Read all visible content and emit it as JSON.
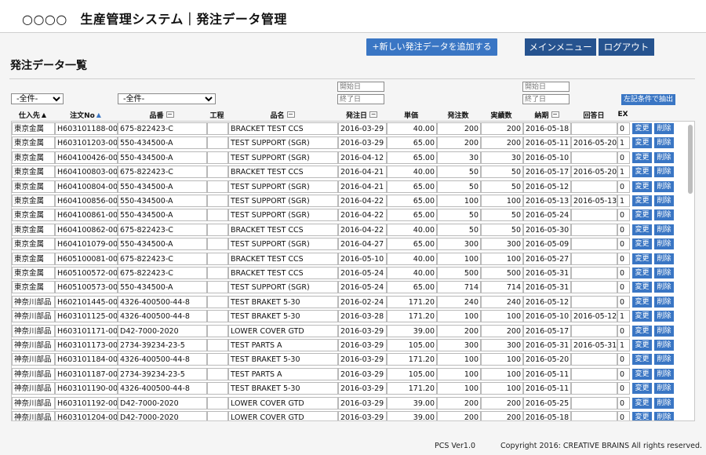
{
  "header": {
    "title": "○○○○　生産管理システム｜発注データ管理",
    "add_button": "+新しい発注データを追加する",
    "main_menu_button": "メインメニュー",
    "logout_button": "ログアウト"
  },
  "page": {
    "title": "発注データ一覧"
  },
  "filters": {
    "supplier_select": "-全件-",
    "part_select": "-全件-",
    "order_date_start_placeholder": "開始日",
    "order_date_end_placeholder": "終了日",
    "delivery_date_start_placeholder": "開始日",
    "delivery_date_end_placeholder": "終了日",
    "apply_button": "左記条件で抽出"
  },
  "columns": {
    "supplier": "仕入先",
    "order_no": "注文No",
    "part_no": "品番",
    "process": "工程",
    "part_name": "品名",
    "order_date": "発注日",
    "unit_price": "単価",
    "order_qty": "発注数",
    "actual_qty": "実績数",
    "delivery_date": "納期",
    "reply_date": "回答日",
    "ex": "EX"
  },
  "icons": {
    "sort_asc": "▲",
    "filter": "−"
  },
  "row_buttons": {
    "edit": "変更",
    "delete": "削除"
  },
  "rows": [
    {
      "supplier": "東京金属",
      "order_no": "H603101188-00",
      "part_no": "675-822423-C",
      "process": "",
      "part_name": "BRACKET TEST CCS",
      "order_date": "2016-03-29",
      "unit_price": "40.00",
      "order_qty": "200",
      "actual_qty": "200",
      "delivery_date": "2016-05-18",
      "reply_date": "",
      "ex": "0"
    },
    {
      "supplier": "東京金属",
      "order_no": "H603101203-00",
      "part_no": "550-434500-A",
      "process": "",
      "part_name": "TEST SUPPORT (SGR)",
      "order_date": "2016-03-29",
      "unit_price": "65.00",
      "order_qty": "200",
      "actual_qty": "200",
      "delivery_date": "2016-05-11",
      "reply_date": "2016-05-20",
      "ex": "1"
    },
    {
      "supplier": "東京金属",
      "order_no": "H604100426-00",
      "part_no": "550-434500-A",
      "process": "",
      "part_name": "TEST SUPPORT (SGR)",
      "order_date": "2016-04-12",
      "unit_price": "65.00",
      "order_qty": "30",
      "actual_qty": "30",
      "delivery_date": "2016-05-10",
      "reply_date": "",
      "ex": "0"
    },
    {
      "supplier": "東京金属",
      "order_no": "H604100803-00",
      "part_no": "675-822423-C",
      "process": "",
      "part_name": "BRACKET TEST CCS",
      "order_date": "2016-04-21",
      "unit_price": "40.00",
      "order_qty": "50",
      "actual_qty": "50",
      "delivery_date": "2016-05-17",
      "reply_date": "2016-05-20",
      "ex": "1"
    },
    {
      "supplier": "東京金属",
      "order_no": "H604100804-00",
      "part_no": "550-434500-A",
      "process": "",
      "part_name": "TEST SUPPORT (SGR)",
      "order_date": "2016-04-21",
      "unit_price": "65.00",
      "order_qty": "50",
      "actual_qty": "50",
      "delivery_date": "2016-05-12",
      "reply_date": "",
      "ex": "0"
    },
    {
      "supplier": "東京金属",
      "order_no": "H604100856-00",
      "part_no": "550-434500-A",
      "process": "",
      "part_name": "TEST SUPPORT (SGR)",
      "order_date": "2016-04-22",
      "unit_price": "65.00",
      "order_qty": "100",
      "actual_qty": "100",
      "delivery_date": "2016-05-13",
      "reply_date": "2016-05-13",
      "ex": "1"
    },
    {
      "supplier": "東京金属",
      "order_no": "H604100861-00",
      "part_no": "550-434500-A",
      "process": "",
      "part_name": "TEST SUPPORT (SGR)",
      "order_date": "2016-04-22",
      "unit_price": "65.00",
      "order_qty": "50",
      "actual_qty": "50",
      "delivery_date": "2016-05-24",
      "reply_date": "",
      "ex": "0"
    },
    {
      "supplier": "東京金属",
      "order_no": "H604100862-00",
      "part_no": "675-822423-C",
      "process": "",
      "part_name": "BRACKET TEST CCS",
      "order_date": "2016-04-22",
      "unit_price": "40.00",
      "order_qty": "50",
      "actual_qty": "50",
      "delivery_date": "2016-05-30",
      "reply_date": "",
      "ex": "0"
    },
    {
      "supplier": "東京金属",
      "order_no": "H604101079-00",
      "part_no": "550-434500-A",
      "process": "",
      "part_name": "TEST SUPPORT (SGR)",
      "order_date": "2016-04-27",
      "unit_price": "65.00",
      "order_qty": "300",
      "actual_qty": "300",
      "delivery_date": "2016-05-09",
      "reply_date": "",
      "ex": "0"
    },
    {
      "supplier": "東京金属",
      "order_no": "H605100081-00",
      "part_no": "675-822423-C",
      "process": "",
      "part_name": "BRACKET TEST CCS",
      "order_date": "2016-05-10",
      "unit_price": "40.00",
      "order_qty": "100",
      "actual_qty": "100",
      "delivery_date": "2016-05-27",
      "reply_date": "",
      "ex": "0"
    },
    {
      "supplier": "東京金属",
      "order_no": "H605100572-00",
      "part_no": "675-822423-C",
      "process": "",
      "part_name": "BRACKET TEST CCS",
      "order_date": "2016-05-24",
      "unit_price": "40.00",
      "order_qty": "500",
      "actual_qty": "500",
      "delivery_date": "2016-05-31",
      "reply_date": "",
      "ex": "0"
    },
    {
      "supplier": "東京金属",
      "order_no": "H605100573-00",
      "part_no": "550-434500-A",
      "process": "",
      "part_name": "TEST SUPPORT (SGR)",
      "order_date": "2016-05-24",
      "unit_price": "65.00",
      "order_qty": "714",
      "actual_qty": "714",
      "delivery_date": "2016-05-31",
      "reply_date": "",
      "ex": "0"
    },
    {
      "supplier": "神奈川部品",
      "order_no": "H602101445-00",
      "part_no": "4326-400500-44-8",
      "process": "",
      "part_name": "TEST BRAKET 5-30",
      "order_date": "2016-02-24",
      "unit_price": "171.20",
      "order_qty": "240",
      "actual_qty": "240",
      "delivery_date": "2016-05-12",
      "reply_date": "",
      "ex": "0"
    },
    {
      "supplier": "神奈川部品",
      "order_no": "H603101125-00",
      "part_no": "4326-400500-44-8",
      "process": "",
      "part_name": "TEST BRAKET 5-30",
      "order_date": "2016-03-28",
      "unit_price": "171.20",
      "order_qty": "100",
      "actual_qty": "100",
      "delivery_date": "2016-05-10",
      "reply_date": "2016-05-12",
      "ex": "1"
    },
    {
      "supplier": "神奈川部品",
      "order_no": "H603101171-00",
      "part_no": "D42-7000-2020",
      "process": "",
      "part_name": "LOWER COVER GTD",
      "order_date": "2016-03-29",
      "unit_price": "39.00",
      "order_qty": "200",
      "actual_qty": "200",
      "delivery_date": "2016-05-17",
      "reply_date": "",
      "ex": "0"
    },
    {
      "supplier": "神奈川部品",
      "order_no": "H603101173-00",
      "part_no": "2734-39234-23-5",
      "process": "",
      "part_name": "TEST PARTS A",
      "order_date": "2016-03-29",
      "unit_price": "105.00",
      "order_qty": "300",
      "actual_qty": "300",
      "delivery_date": "2016-05-31",
      "reply_date": "2016-05-31",
      "ex": "1"
    },
    {
      "supplier": "神奈川部品",
      "order_no": "H603101184-00",
      "part_no": "4326-400500-44-8",
      "process": "",
      "part_name": "TEST BRAKET 5-30",
      "order_date": "2016-03-29",
      "unit_price": "171.20",
      "order_qty": "100",
      "actual_qty": "100",
      "delivery_date": "2016-05-20",
      "reply_date": "",
      "ex": "0"
    },
    {
      "supplier": "神奈川部品",
      "order_no": "H603101187-00",
      "part_no": "2734-39234-23-5",
      "process": "",
      "part_name": "TEST PARTS A",
      "order_date": "2016-03-29",
      "unit_price": "105.00",
      "order_qty": "100",
      "actual_qty": "100",
      "delivery_date": "2016-05-11",
      "reply_date": "",
      "ex": "0"
    },
    {
      "supplier": "神奈川部品",
      "order_no": "H603101190-00",
      "part_no": "4326-400500-44-8",
      "process": "",
      "part_name": "TEST BRAKET 5-30",
      "order_date": "2016-03-29",
      "unit_price": "171.20",
      "order_qty": "100",
      "actual_qty": "100",
      "delivery_date": "2016-05-11",
      "reply_date": "",
      "ex": "0"
    },
    {
      "supplier": "神奈川部品",
      "order_no": "H603101192-00",
      "part_no": "D42-7000-2020",
      "process": "",
      "part_name": "LOWER COVER GTD",
      "order_date": "2016-03-29",
      "unit_price": "39.00",
      "order_qty": "200",
      "actual_qty": "200",
      "delivery_date": "2016-05-25",
      "reply_date": "",
      "ex": "0"
    },
    {
      "supplier": "神奈川部品",
      "order_no": "H603101204-00",
      "part_no": "D42-7000-2020",
      "process": "",
      "part_name": "LOWER COVER GTD",
      "order_date": "2016-03-29",
      "unit_price": "39.00",
      "order_qty": "200",
      "actual_qty": "200",
      "delivery_date": "2016-05-18",
      "reply_date": "",
      "ex": "0"
    }
  ],
  "footer": {
    "version": "PCS Ver1.0",
    "copyright": "Copyright 2016: CREATIVE BRAINS All rights reserved."
  }
}
